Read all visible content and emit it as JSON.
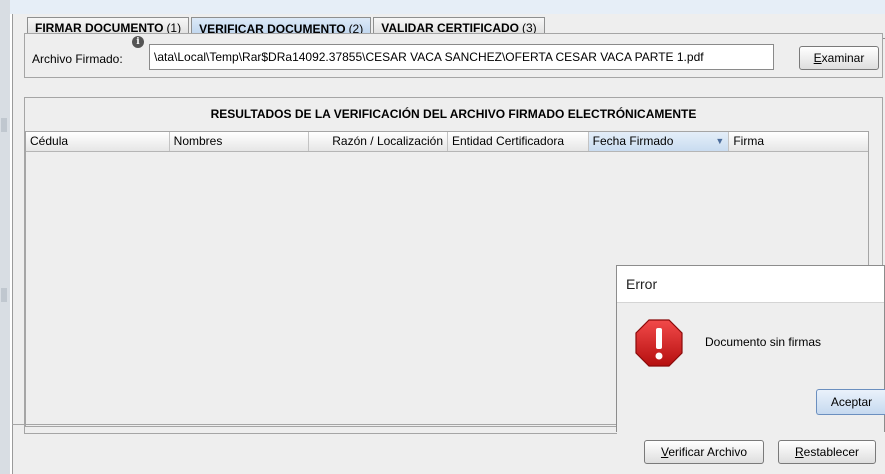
{
  "tabs": [
    {
      "label": "FIRMAR DOCUMENTO",
      "num": "(1)",
      "active": false
    },
    {
      "label": "VERIFICAR DOCUMENTO",
      "num": "(2)",
      "active": true
    },
    {
      "label": "VALIDAR CERTIFICADO",
      "num": "(3)",
      "active": false
    }
  ],
  "file": {
    "label": "Archivo Firmado:",
    "info_icon": "info-icon",
    "value": "\\ata\\Local\\Temp\\Rar$DRa14092.37855\\CESAR VACA SANCHEZ\\OFERTA CESAR VACA PARTE 1.pdf",
    "browse_mnemonic": "E",
    "browse_rest": "xaminar"
  },
  "results": {
    "title": "RESULTADOS DE LA VERIFICACIÓN DEL ARCHIVO FIRMADO ELECTRÓNICAMENTE",
    "columns": [
      "Cédula",
      "Nombres",
      "Razón / Localización",
      "Entidad Certificadora",
      "Fecha Firmado",
      "Firma"
    ],
    "sort_icon": "sort-descending-icon"
  },
  "actions": {
    "verify_mnemonic": "V",
    "verify_rest": "erificar Archivo",
    "reset_mnemonic": "R",
    "reset_rest": "establecer"
  },
  "dialog": {
    "title": "Error",
    "icon": "error-icon",
    "message": "Documento sin firmas",
    "ok_label": "Aceptar"
  },
  "colors": {
    "active_tab": "#b8d1ec",
    "error_red": "#d61f1f"
  }
}
